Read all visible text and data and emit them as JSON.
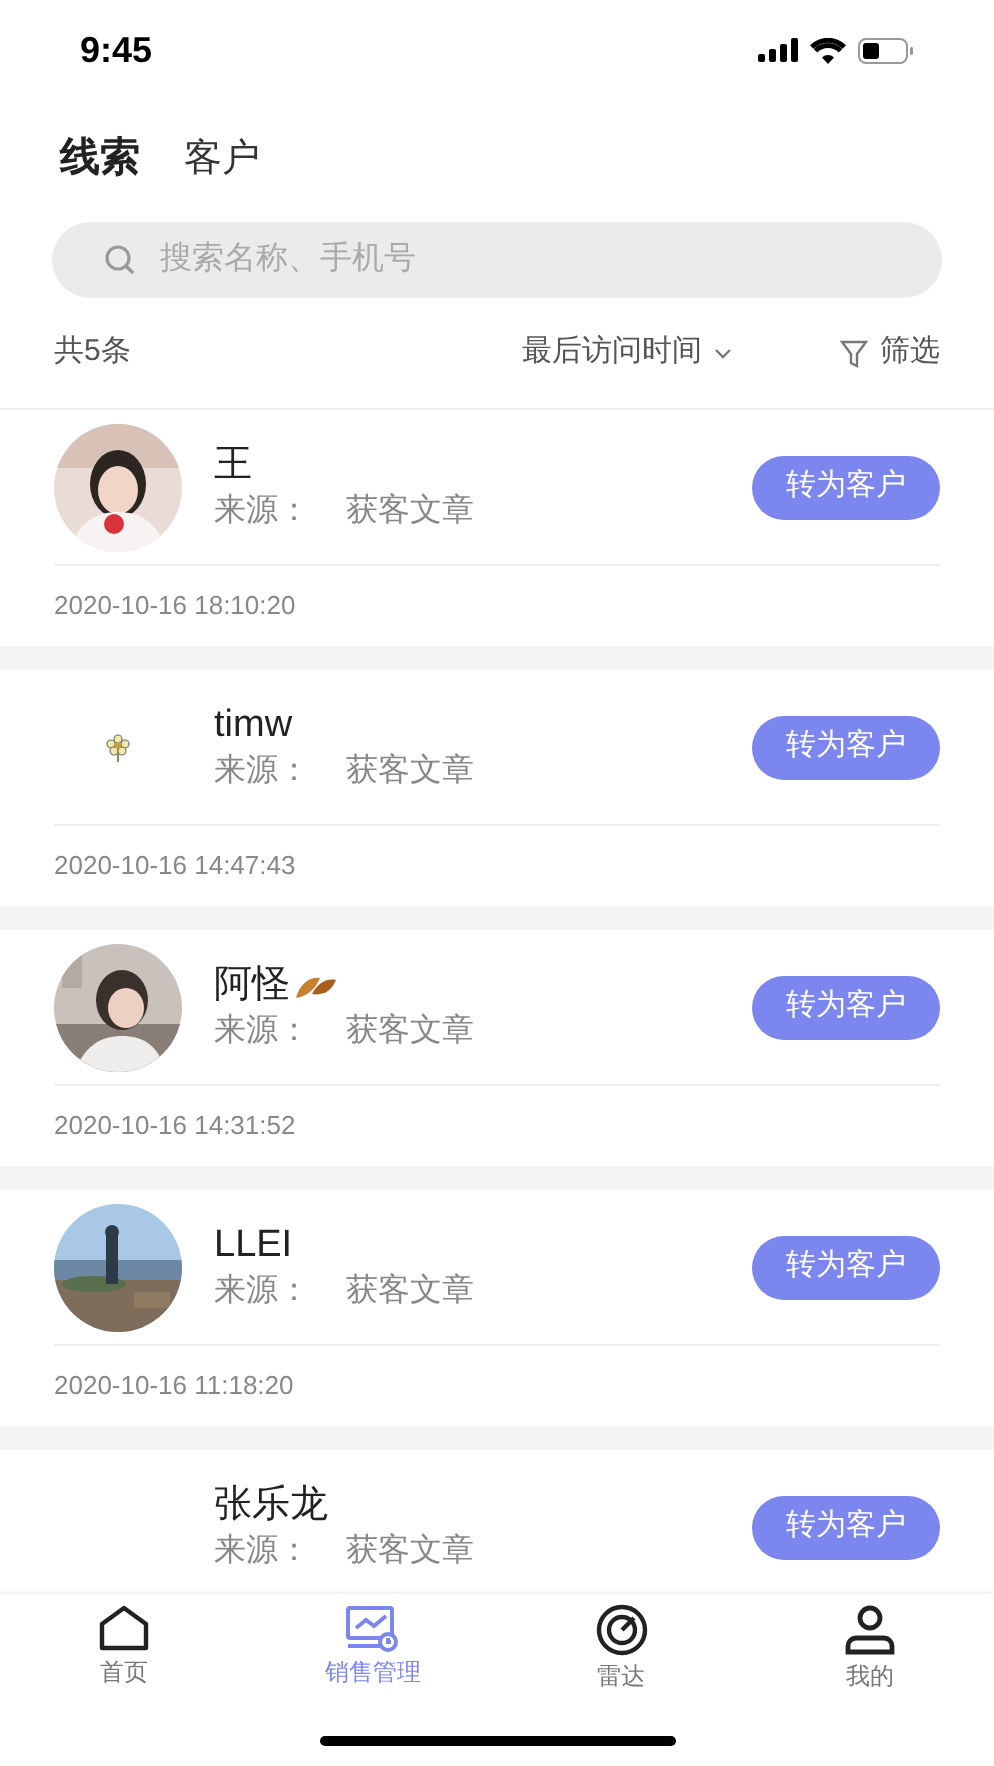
{
  "status_bar": {
    "time": "9:45"
  },
  "tabs": [
    {
      "label": "线索",
      "selected": true
    },
    {
      "label": "客户",
      "selected": false
    }
  ],
  "search": {
    "placeholder": "搜索名称、手机号"
  },
  "toolbar": {
    "count": "共5条",
    "sort": "最后访问时间",
    "filter": "筛选"
  },
  "leads": [
    {
      "name": "王",
      "source_label": "来源：",
      "source": "获客文章",
      "button": "转为客户",
      "time": "2020-10-16 18:10:20"
    },
    {
      "avatar": {
        "kind": "flower"
      },
      "name": "timw",
      "source_label": "来源：",
      "source": "获客文章",
      "button": "转为客户",
      "time": "2020-10-16 14:47:43"
    },
    {
      "name": "阿怪",
      "name_badge": {
        "kind": "leaf"
      },
      "source_label": "来源：",
      "source": "获客文章",
      "button": "转为客户",
      "time": "2020-10-16 14:31:52"
    },
    {
      "name": "LLEI",
      "source_label": "来源：",
      "source": "获客文章",
      "button": "转为客户",
      "time": "2020-10-16 11:18:20"
    },
    {
      "name": "张乐龙",
      "source_label": "来源：",
      "source": "获客文章",
      "button": "转为客户"
    }
  ],
  "tab_bar": [
    {
      "kind": "home",
      "label": "首页",
      "selected": false
    },
    {
      "kind": "sales",
      "label": "销售管理",
      "selected": true
    },
    {
      "kind": "radar",
      "label": "雷达",
      "selected": false
    },
    {
      "kind": "person",
      "label": "我的",
      "selected": false
    }
  ]
}
